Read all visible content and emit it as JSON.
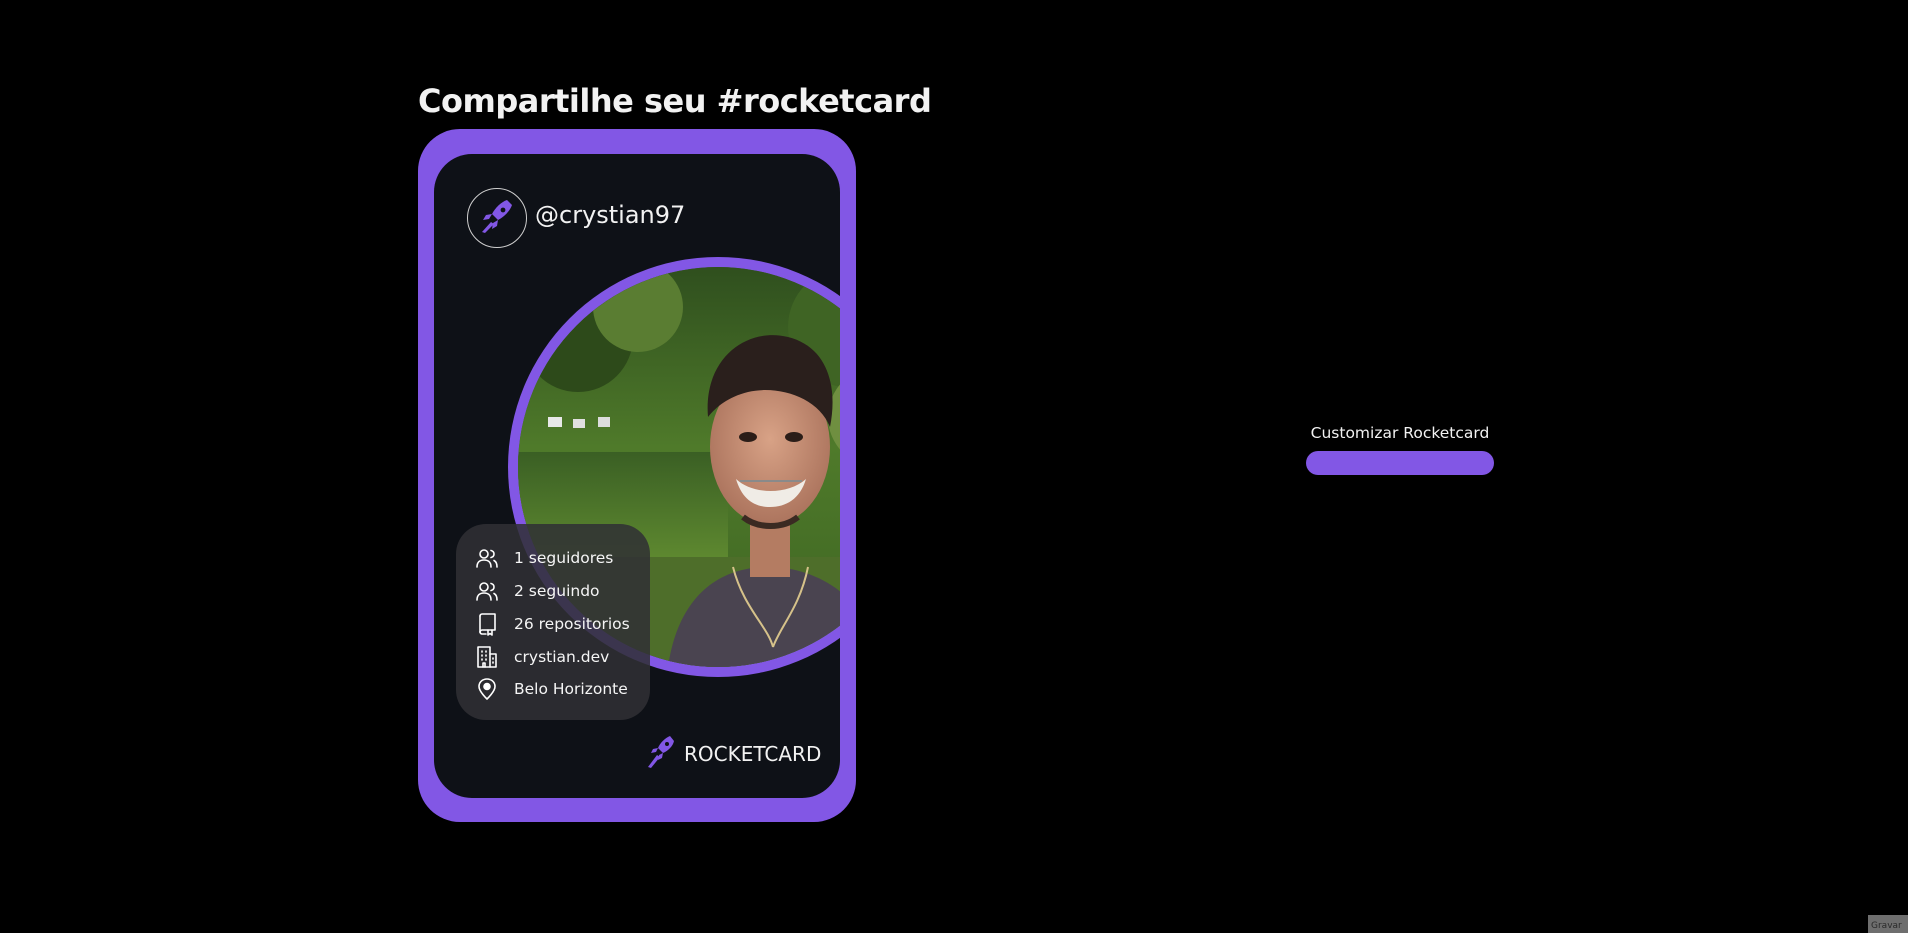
{
  "page": {
    "title": "Compartilhe seu #rocketcard"
  },
  "card": {
    "username": "@crystian97",
    "stats": [
      {
        "icon": "users-icon",
        "label": "1 seguidores"
      },
      {
        "icon": "users-icon",
        "label": "2 seguindo"
      },
      {
        "icon": "repository-icon",
        "label": "26 repositorios"
      },
      {
        "icon": "building-icon",
        "label": "crystian.dev"
      },
      {
        "icon": "map-pin-icon",
        "label": "Belo Horizonte"
      }
    ],
    "brand_label": "ROCKETCARD",
    "logo_icon": "rocket-icon",
    "profile_photo": "profile-photo"
  },
  "customize": {
    "label": "Customizar Rocketcard"
  },
  "corner": {
    "label": "Gravar"
  },
  "colors": {
    "accent": "#8257e5",
    "card_background": "#0e1117",
    "page_background": "#000000",
    "stats_background": "#303034"
  }
}
